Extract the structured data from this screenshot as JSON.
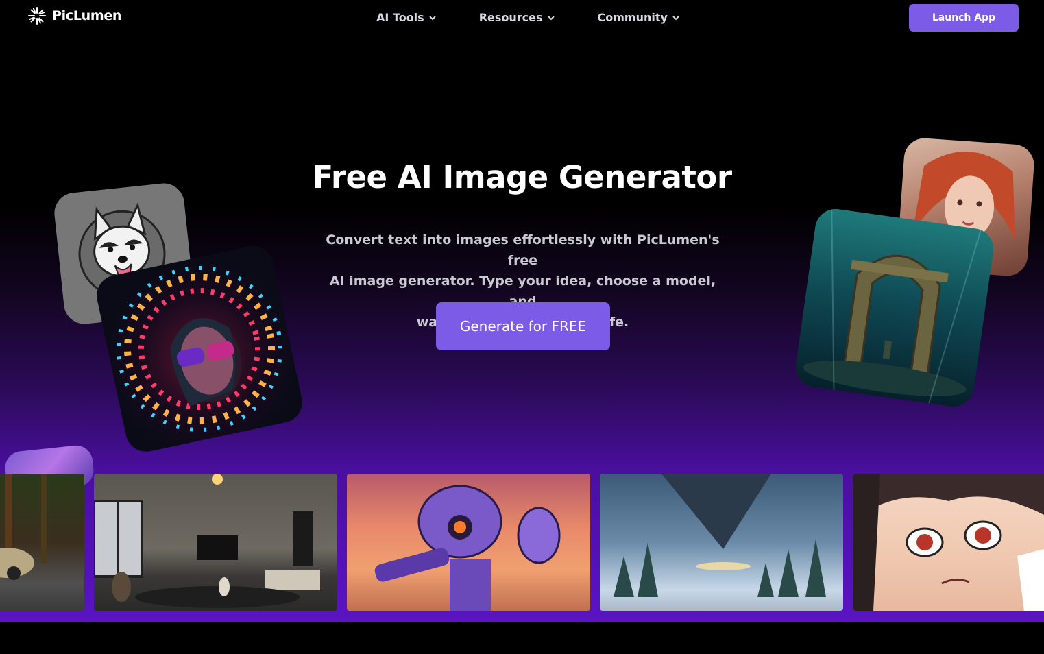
{
  "brand": {
    "name": "PicLumen",
    "logo_icon": "sparkle-burst-icon"
  },
  "nav": {
    "items": [
      {
        "label": "AI Tools",
        "icon": "chevron-down-icon"
      },
      {
        "label": "Resources",
        "icon": "chevron-down-icon"
      },
      {
        "label": "Community",
        "icon": "chevron-down-icon"
      }
    ],
    "launch_label": "Launch App"
  },
  "hero": {
    "title": "Free AI Image Generator",
    "subtitle_lines": [
      "Convert text into images effortlessly with PicLumen's free",
      "AI image generator. Type your idea, choose a model, and",
      "watch your text come to life."
    ],
    "cta_label": "Generate for FREE"
  },
  "colors": {
    "accent": "#7c5ce6",
    "background": "#000000",
    "gradient_end": "#5a14c4"
  }
}
